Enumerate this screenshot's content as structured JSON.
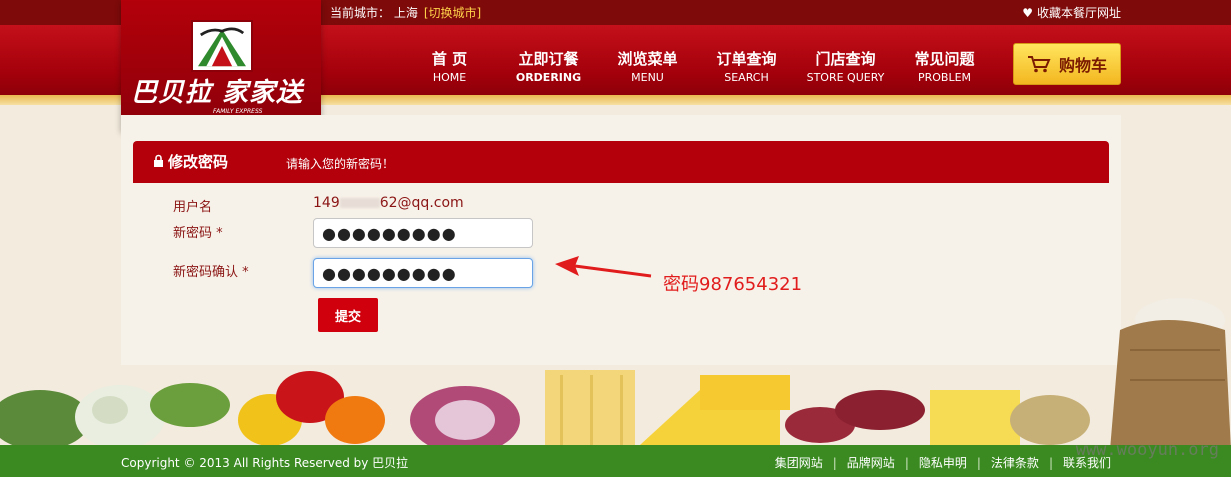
{
  "topbar": {
    "city_label": "当前城市： 上海",
    "switch_city": "[切换城市]",
    "favorite": "收藏本餐厅网址"
  },
  "logo": {
    "brand": "巴贝拉 家家送",
    "sub": "FAMILY EXPRESS"
  },
  "nav": [
    {
      "cn": "首 页",
      "en": "HOME"
    },
    {
      "cn": "立即订餐",
      "en": "ORDERING"
    },
    {
      "cn": "浏览菜单",
      "en": "MENU"
    },
    {
      "cn": "订单查询",
      "en": "SEARCH"
    },
    {
      "cn": "门店查询",
      "en": "STORE QUERY"
    },
    {
      "cn": "常见问题",
      "en": "PROBLEM"
    }
  ],
  "cart": {
    "label": "购物车"
  },
  "form": {
    "title": "修改密码",
    "hint": "请输入您的新密码！",
    "username_label": "用户名",
    "username_prefix": "149",
    "username_suffix": "62@qq.com",
    "new_password_label": "新密码 *",
    "new_password_value": "●●●●●●●●●",
    "confirm_password_label": "新密码确认 *",
    "confirm_password_value": "●●●●●●●●●",
    "submit_label": "提交"
  },
  "annotation": {
    "text": "密码987654321"
  },
  "footer": {
    "copyright": "Copyright © 2013 All Rights Reserved by 巴贝拉",
    "links": [
      "集团网站",
      "品牌网站",
      "隐私申明",
      "法律条款",
      "联系我们"
    ]
  },
  "watermark": "www.wooyun.org"
}
